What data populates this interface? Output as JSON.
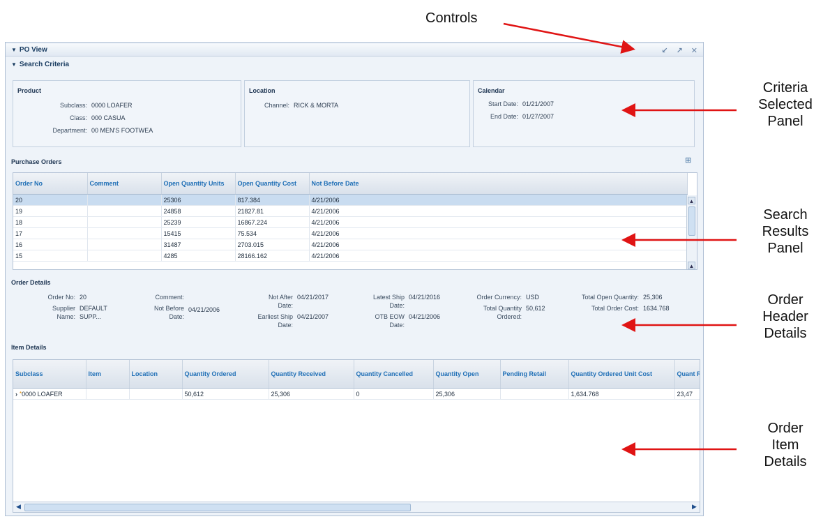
{
  "annotations": {
    "controls": "Controls",
    "criteria": [
      "Criteria",
      "Selected",
      "Panel"
    ],
    "search": [
      "Search",
      "Results",
      "Panel"
    ],
    "header": [
      "Order",
      "Header",
      "Details"
    ],
    "items": [
      "Order",
      "Item",
      "Details"
    ]
  },
  "view": {
    "title": "PO View",
    "search_criteria": "Search Criteria"
  },
  "criteria": {
    "product": {
      "title": "Product",
      "fields": [
        {
          "k": "Subclass:",
          "v": "0000 LOAFER"
        },
        {
          "k": "Class:",
          "v": "000 CASUA"
        },
        {
          "k": "Department:",
          "v": "00 MEN'S FOOTWEA"
        }
      ]
    },
    "location": {
      "title": "Location",
      "fields": [
        {
          "k": "Channel:",
          "v": "RICK & MORTA"
        }
      ]
    },
    "calendar": {
      "title": "Calendar",
      "fields": [
        {
          "k": "Start Date:",
          "v": "01/21/2007"
        },
        {
          "k": "End Date:",
          "v": "01/27/2007"
        }
      ]
    }
  },
  "po": {
    "title": "Purchase Orders",
    "columns": [
      "Order No",
      "Comment",
      "Open Quantity Units",
      "Open Quantity Cost",
      "Not Before Date"
    ],
    "rows": [
      [
        "20",
        "",
        "25306",
        "817.384",
        "4/21/2006"
      ],
      [
        "19",
        "",
        "24858",
        "21827.81",
        "4/21/2006"
      ],
      [
        "18",
        "",
        "25239",
        "16867.224",
        "4/21/2006"
      ],
      [
        "17",
        "",
        "15415",
        "75.534",
        "4/21/2006"
      ],
      [
        "16",
        "",
        "31487",
        "2703.015",
        "4/21/2006"
      ],
      [
        "15",
        "",
        "4285",
        "28166.162",
        "4/21/2006"
      ]
    ]
  },
  "order_details": {
    "title": "Order Details",
    "order_no": {
      "k": "Order No:",
      "v": "20"
    },
    "supplier": {
      "k1": "Supplier",
      "k2": "Name:",
      "v1": "DEFAULT",
      "v2": "SUPP..."
    },
    "comment": {
      "k": "Comment:",
      "v": ""
    },
    "not_before": {
      "k1": "Not Before",
      "k2": "Date:",
      "v": "04/21/2006"
    },
    "not_after": {
      "k1": "Not After",
      "k2": "Date:",
      "v": "04/21/2017"
    },
    "earliest_ship": {
      "k1": "Earliest Ship",
      "k2": "Date:",
      "v": "04/21/2007"
    },
    "latest_ship": {
      "k1": "Latest Ship",
      "k2": "Date:",
      "v": "04/21/2016"
    },
    "otb_eow": {
      "k1": "OTB EOW",
      "k2": "Date:",
      "v": "04/21/2006"
    },
    "currency": {
      "k": "Order Currency:",
      "v": "USD"
    },
    "total_qty": {
      "k1": "Total Quantity",
      "k2": "Ordered:",
      "v": "50,612"
    },
    "total_open": {
      "k": "Total Open Quantity:",
      "v": "25,306"
    },
    "total_cost": {
      "k": "Total Order Cost:",
      "v": "1634.768"
    }
  },
  "items": {
    "title": "Item Details",
    "columns": [
      "Subclass",
      "Item",
      "Location",
      "Quantity Ordered",
      "Quantity Received",
      "Quantity Cancelled",
      "Quantity Open",
      "Pending Retail",
      "Quantity Ordered Unit Cost",
      "Quant Recei"
    ],
    "rows": [
      [
        "0000 LOAFER",
        "",
        "",
        "50,612",
        "25,306",
        "0",
        "25,306",
        "",
        "1,634.768",
        "23,47"
      ]
    ]
  }
}
